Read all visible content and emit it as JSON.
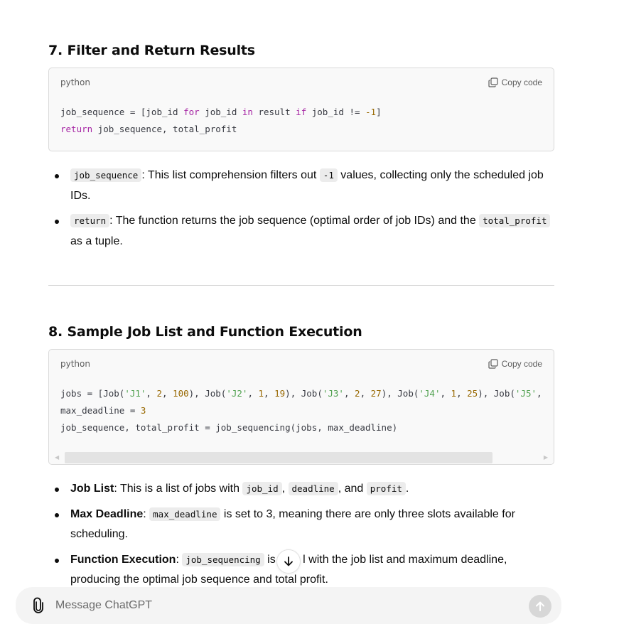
{
  "section7": {
    "heading": "7. Filter and Return Results",
    "code_block": {
      "language": "python",
      "copy_label": "Copy code",
      "lines": [
        [
          [
            "",
            "job_sequence = [job_id "
          ],
          [
            "kw",
            "for"
          ],
          [
            "",
            " job_id "
          ],
          [
            "kw",
            "in"
          ],
          [
            "",
            " result "
          ],
          [
            "kw",
            "if"
          ],
          [
            "",
            " job_id != "
          ],
          [
            "num",
            "-1"
          ],
          [
            "",
            "]"
          ]
        ],
        [
          [
            "kw",
            "return"
          ],
          [
            "",
            " job_sequence, total_profit"
          ]
        ]
      ]
    },
    "bullets": [
      {
        "code1": "job_sequence",
        "text1": ": This list comprehension filters out ",
        "code2": "-1",
        "text2": " values, collecting only the scheduled job IDs."
      },
      {
        "code1": "return",
        "text1": ": The function returns the job sequence (optimal order of job IDs) and the ",
        "code2": "total_profit",
        "text2": " as a tuple."
      }
    ]
  },
  "section8": {
    "heading": "8. Sample Job List and Function Execution",
    "code_block": {
      "language": "python",
      "copy_label": "Copy code",
      "lines": [
        [
          [
            "",
            "jobs = [Job("
          ],
          [
            "str",
            "'J1'"
          ],
          [
            "",
            ", "
          ],
          [
            "num",
            "2"
          ],
          [
            "",
            ", "
          ],
          [
            "num",
            "100"
          ],
          [
            "",
            "), Job("
          ],
          [
            "str",
            "'J2'"
          ],
          [
            "",
            ", "
          ],
          [
            "num",
            "1"
          ],
          [
            "",
            ", "
          ],
          [
            "num",
            "19"
          ],
          [
            "",
            "), Job("
          ],
          [
            "str",
            "'J3'"
          ],
          [
            "",
            ", "
          ],
          [
            "num",
            "2"
          ],
          [
            "",
            ", "
          ],
          [
            "num",
            "27"
          ],
          [
            "",
            "), Job("
          ],
          [
            "str",
            "'J4'"
          ],
          [
            "",
            ", "
          ],
          [
            "num",
            "1"
          ],
          [
            "",
            ", "
          ],
          [
            "num",
            "25"
          ],
          [
            "",
            "), Job("
          ],
          [
            "str",
            "'J5'"
          ],
          [
            "",
            ","
          ]
        ],
        [
          [
            "",
            "max_deadline = "
          ],
          [
            "num",
            "3"
          ]
        ],
        [
          [
            "",
            "job_sequence, total_profit = job_sequencing(jobs, max_deadline)"
          ]
        ]
      ]
    },
    "bullets": [
      {
        "label": "Job List",
        "text1": ": This is a list of jobs with ",
        "code1": "job_id",
        "text2": ", ",
        "code2": "deadline",
        "text3": ", and ",
        "code3": "profit",
        "text4": "."
      },
      {
        "label": "Max Deadline",
        "text1": ": ",
        "code1": "max_deadline",
        "text2": " is set to 3, meaning there are only three slots available for scheduling."
      },
      {
        "label": "Function Execution",
        "text1": ": ",
        "code1": "job_sequencing",
        "text2": " is c",
        "text3": "l with the job list and maximum deadline, producing the optimal job sequence and total profit."
      }
    ]
  },
  "composer": {
    "placeholder": "Message ChatGPT"
  },
  "icons": {
    "copy": "copy-icon",
    "attach": "paperclip-icon",
    "send": "arrow-up-icon",
    "scroll_down": "arrow-down-icon"
  },
  "colors": {
    "keyword": "#a626a4",
    "number": "#986801",
    "string": "#50a14f",
    "code_bg": "#f9f9f9",
    "inline_code_bg": "#ececec"
  }
}
